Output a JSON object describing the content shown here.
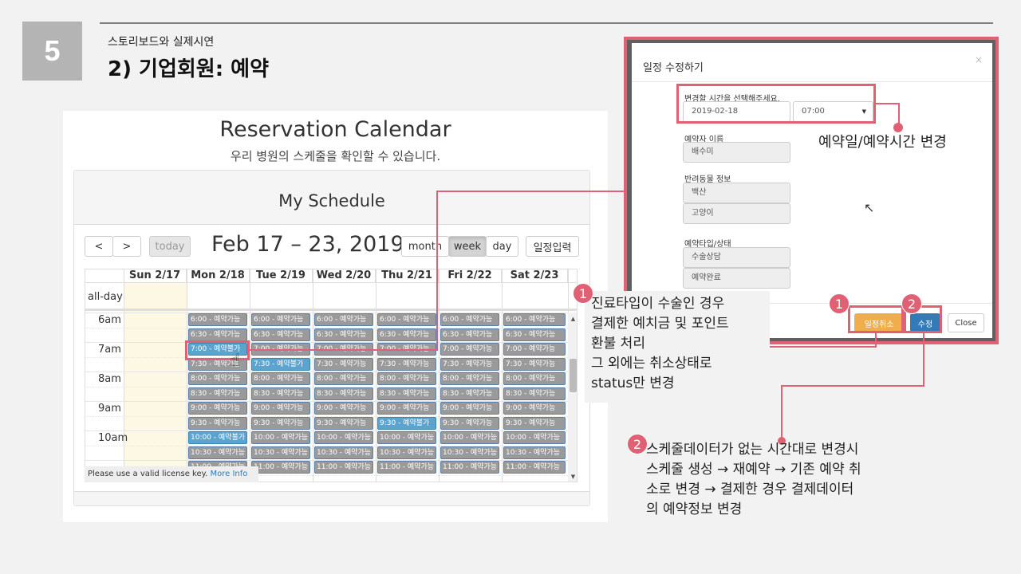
{
  "slide": {
    "page_number": "5",
    "subtitle": "스토리보드와 실제시연",
    "title": "2) 기업회원: 예약"
  },
  "calendar": {
    "title": "Reservation Calendar",
    "subtitle": "우리 병원의 스케줄을 확인할 수 있습니다.",
    "panel_title": "My Schedule",
    "prev_label": "<",
    "next_label": ">",
    "today_label": "today",
    "range": "Feb 17 – 23, 2019",
    "month_label": "month",
    "week_label": "week",
    "day_label": "day",
    "add_label": "일정입력",
    "days": [
      "Sun 2/17",
      "Mon 2/18",
      "Tue 2/19",
      "Wed 2/20",
      "Thu 2/21",
      "Fri 2/22",
      "Sat 2/23"
    ],
    "allday_label": "all-day",
    "times": [
      "6am",
      "7am",
      "8am",
      "9am",
      "10am"
    ],
    "slots": [
      "6:00",
      "6:30",
      "7:00",
      "7:30",
      "8:00",
      "8:30",
      "9:00",
      "9:30",
      "10:00",
      "10:30",
      "11:00"
    ],
    "available": "예약가능",
    "unavailable": "예약불가",
    "booked": [
      {
        "day": 1,
        "slot": 2
      },
      {
        "day": 2,
        "slot": 3
      },
      {
        "day": 4,
        "slot": 7
      },
      {
        "day": 1,
        "slot": 8
      }
    ],
    "license_text": "Please use a valid license key.",
    "license_link": "More Info"
  },
  "annotation1": {
    "number": "1",
    "text": "진료타입이 수술인 경우\n결제한 예치금 및 포인트\n환불 처리\n그 외에는 취소상태로\nstatus만 변경"
  },
  "modal": {
    "title": "일정 수정하기",
    "close_x": "×",
    "time_label": "변경할 시간을 선택해주세요.",
    "date_value": "2019-02-18",
    "time_value": "07:00",
    "name_label": "예약자 이름",
    "name_value": "배수미",
    "pet_label": "반려동물 정보",
    "pet_values": [
      "백산",
      "고양이"
    ],
    "type_label": "예약타입/상태",
    "type_values": [
      "수술상담",
      "예약완료"
    ],
    "cancel_btn": "일정취소",
    "edit_btn": "수정",
    "close_btn": "Close",
    "annotation": "예약일/예약시간 변경",
    "badge1": "1",
    "badge2": "2"
  },
  "annotation2": {
    "number": "2",
    "text": "스케줄데이터가 없는 시간대로 변경시\n스케줄 생성 → 재예약 → 기존 예약 취\n소로 변경 → 결제한 경우 결제데이터\n의 예약정보 변경"
  },
  "colors": {
    "accent": "#e06173",
    "event_gray": "#9a9a9a",
    "event_blue": "#5ba4cf",
    "warning": "#f0ad4e",
    "primary": "#337ab7"
  }
}
